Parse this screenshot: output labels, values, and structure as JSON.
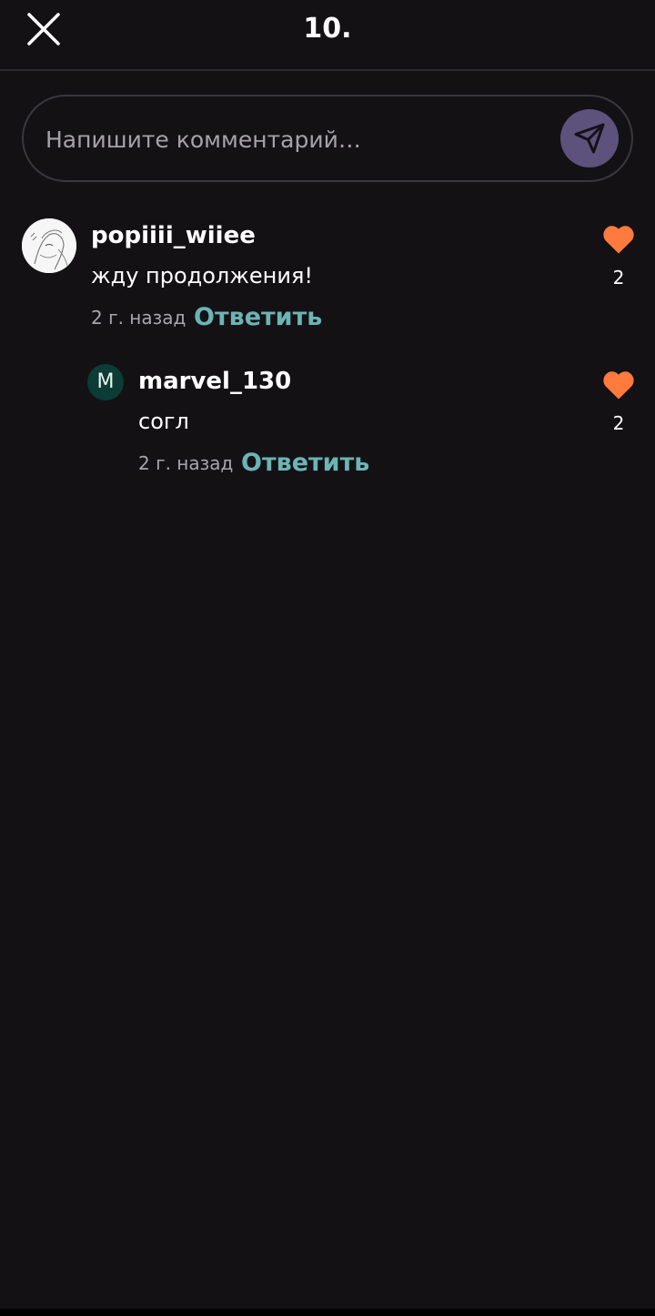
{
  "header": {
    "title": "10."
  },
  "composer": {
    "placeholder": "Напишите комментарий…"
  },
  "comments": [
    {
      "username": "popiiii_wiiee",
      "text": "жду продолжения!",
      "time": "2 г. назад",
      "reply_label": "Ответить",
      "likes": "2"
    },
    {
      "avatar_letter": "M",
      "username": "marvel_130",
      "text": "согл",
      "time": "2 г. назад",
      "reply_label": "Ответить",
      "likes": "2"
    }
  ],
  "colors": {
    "background": "#141115",
    "accent_reply": "#6cb4b5",
    "heart": "#ff7a3d",
    "send_button": "#5c527c"
  },
  "icons": {
    "close": "close-icon",
    "send": "send-icon",
    "like": "heart-icon"
  }
}
